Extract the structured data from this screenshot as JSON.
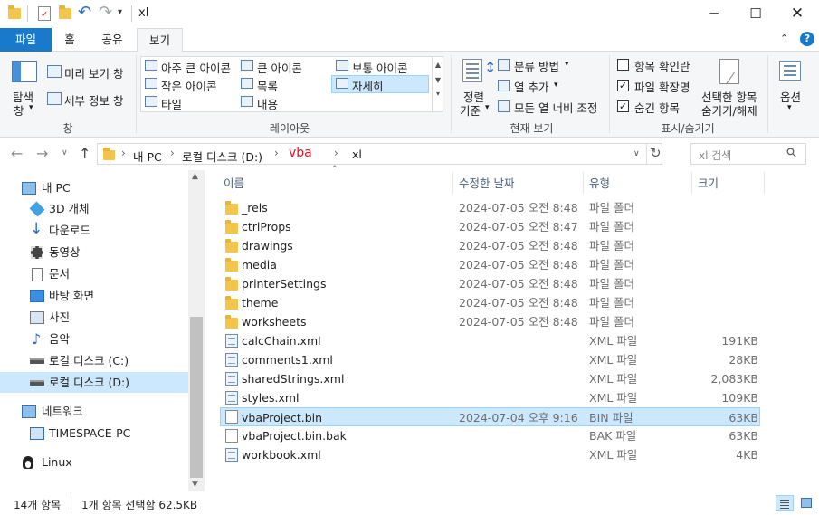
{
  "window": {
    "title": "xl"
  },
  "ribbon_tabs": [
    "파일",
    "홈",
    "공유",
    "보기"
  ],
  "ribbon": {
    "pane": {
      "nav_pane_line1": "탐색",
      "nav_pane_line2": "창",
      "preview": "미리 보기 창",
      "details": "세부 정보 창",
      "group_label": "창"
    },
    "layout": {
      "items": [
        "아주 큰 아이콘",
        "큰 아이콘",
        "보통 아이콘",
        "작은 아이콘",
        "목록",
        "자세히",
        "타일",
        "내용"
      ],
      "selected": "자세히",
      "group_label": "레이아웃"
    },
    "current_view": {
      "sort_line1": "정렬",
      "sort_line2": "기준",
      "group_by": "분류 방법",
      "add_columns": "열 추가",
      "fit_columns": "모든 열 너비 조정",
      "group_label": "현재 보기"
    },
    "show_hide": {
      "item_checkboxes": "항목 확인란",
      "file_extensions": "파일 확장명",
      "hidden_items": "숨긴 항목",
      "hide_selected_line1": "선택한 항목",
      "hide_selected_line2": "숨기기/해제",
      "group_label": "표시/숨기기",
      "checked": {
        "item_checkboxes": false,
        "file_extensions": true,
        "hidden_items": true
      }
    },
    "options": {
      "label": "옵션"
    }
  },
  "address": {
    "crumbs": [
      "내 PC",
      "로컬 디스크 (D:)",
      "vba",
      "xl"
    ],
    "search_placeholder": "xl 검색"
  },
  "nav_pane": [
    {
      "label": "내 PC",
      "icon": "pc-icon"
    },
    {
      "label": "3D 개체",
      "icon": "cube-icon"
    },
    {
      "label": "다운로드",
      "icon": "download-icon"
    },
    {
      "label": "동영상",
      "icon": "video-icon"
    },
    {
      "label": "문서",
      "icon": "document-icon"
    },
    {
      "label": "바탕 화면",
      "icon": "desktop-icon"
    },
    {
      "label": "사진",
      "icon": "picture-icon"
    },
    {
      "label": "음악",
      "icon": "music-icon"
    },
    {
      "label": "로컬 디스크 (C:)",
      "icon": "drive-icon"
    },
    {
      "label": "로컬 디스크 (D:)",
      "icon": "drive-icon"
    },
    {
      "label": "네트워크",
      "icon": "network-icon"
    },
    {
      "label": "TIMESPACE-PC",
      "icon": "computer-icon"
    },
    {
      "label": "Linux",
      "icon": "linux-icon"
    }
  ],
  "columns": {
    "name": "이름",
    "date": "수정한 날짜",
    "type": "유형",
    "size": "크기"
  },
  "files": [
    {
      "name": "_rels",
      "date": "2024-07-05 오전 8:48",
      "type": "파일 폴더",
      "size": "",
      "kind": "folder"
    },
    {
      "name": "ctrlProps",
      "date": "2024-07-05 오전 8:47",
      "type": "파일 폴더",
      "size": "",
      "kind": "folder"
    },
    {
      "name": "drawings",
      "date": "2024-07-05 오전 8:48",
      "type": "파일 폴더",
      "size": "",
      "kind": "folder"
    },
    {
      "name": "media",
      "date": "2024-07-05 오전 8:48",
      "type": "파일 폴더",
      "size": "",
      "kind": "folder"
    },
    {
      "name": "printerSettings",
      "date": "2024-07-05 오전 8:48",
      "type": "파일 폴더",
      "size": "",
      "kind": "folder"
    },
    {
      "name": "theme",
      "date": "2024-07-05 오전 8:48",
      "type": "파일 폴더",
      "size": "",
      "kind": "folder"
    },
    {
      "name": "worksheets",
      "date": "2024-07-05 오전 8:48",
      "type": "파일 폴더",
      "size": "",
      "kind": "folder"
    },
    {
      "name": "calcChain.xml",
      "date": "",
      "type": "XML 파일",
      "size": "191KB",
      "kind": "xml"
    },
    {
      "name": "comments1.xml",
      "date": "",
      "type": "XML 파일",
      "size": "28KB",
      "kind": "xml"
    },
    {
      "name": "sharedStrings.xml",
      "date": "",
      "type": "XML 파일",
      "size": "2,083KB",
      "kind": "xml"
    },
    {
      "name": "styles.xml",
      "date": "",
      "type": "XML 파일",
      "size": "109KB",
      "kind": "xml"
    },
    {
      "name": "vbaProject.bin",
      "date": "2024-07-04 오후 9:16",
      "type": "BIN 파일",
      "size": "63KB",
      "kind": "doc"
    },
    {
      "name": "vbaProject.bin.bak",
      "date": "",
      "type": "BAK 파일",
      "size": "63KB",
      "kind": "doc"
    },
    {
      "name": "workbook.xml",
      "date": "",
      "type": "XML 파일",
      "size": "4KB",
      "kind": "xml"
    }
  ],
  "selected_file": "vbaProject.bin",
  "status": {
    "count": "14개 항목",
    "selection": "1개 항목 선택함 62.5KB"
  },
  "colors": {
    "accent": "#1979ca",
    "selection": "#cce8ff",
    "vba_crumb": "#e81123"
  }
}
